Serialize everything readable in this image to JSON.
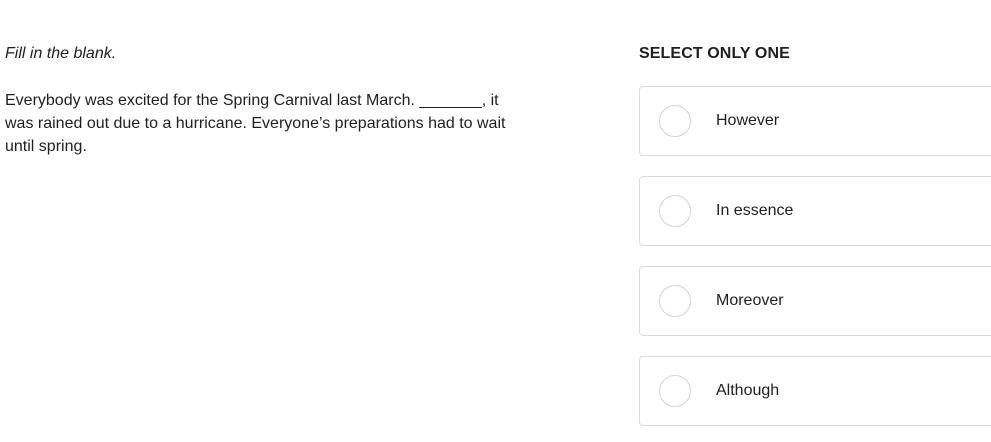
{
  "question": {
    "instruction": "Fill in the blank.",
    "passage": "Everybody was excited for the Spring Carnival last March. _______, it was rained out due to a hurricane. Everyone’s preparations had to wait until spring."
  },
  "answers": {
    "select_label": "SELECT ONLY ONE",
    "options": [
      {
        "label": "However"
      },
      {
        "label": "In essence"
      },
      {
        "label": "Moreover"
      },
      {
        "label": "Although"
      }
    ]
  }
}
